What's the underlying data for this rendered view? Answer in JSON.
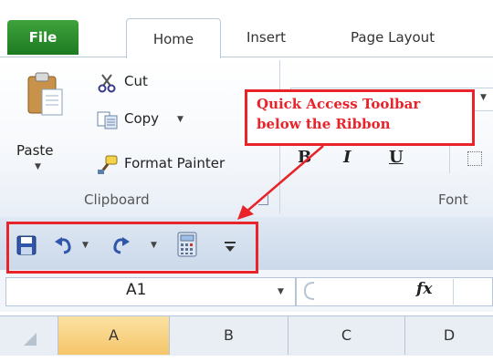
{
  "tabs": {
    "file": "File",
    "home": "Home",
    "insert": "Insert",
    "page_layout": "Page Layout"
  },
  "clipboard": {
    "paste_label": "Paste",
    "cut_label": "Cut",
    "copy_label": "Copy",
    "format_painter_label": "Format Painter",
    "group_label": "Clipboard"
  },
  "font_group": {
    "group_label": "Font",
    "bold": "B",
    "italic": "I",
    "underline": "U"
  },
  "callout": {
    "line1": "Quick Access Toolbar",
    "line2": "below the Ribbon"
  },
  "formula_bar": {
    "name_box": "A1",
    "fx": "fx"
  },
  "columns": [
    "A",
    "B",
    "C",
    "D"
  ],
  "colors": {
    "file_tab": "#2a8a2e",
    "callout_red": "#e8232a",
    "selected_header": "#f7d27d"
  }
}
